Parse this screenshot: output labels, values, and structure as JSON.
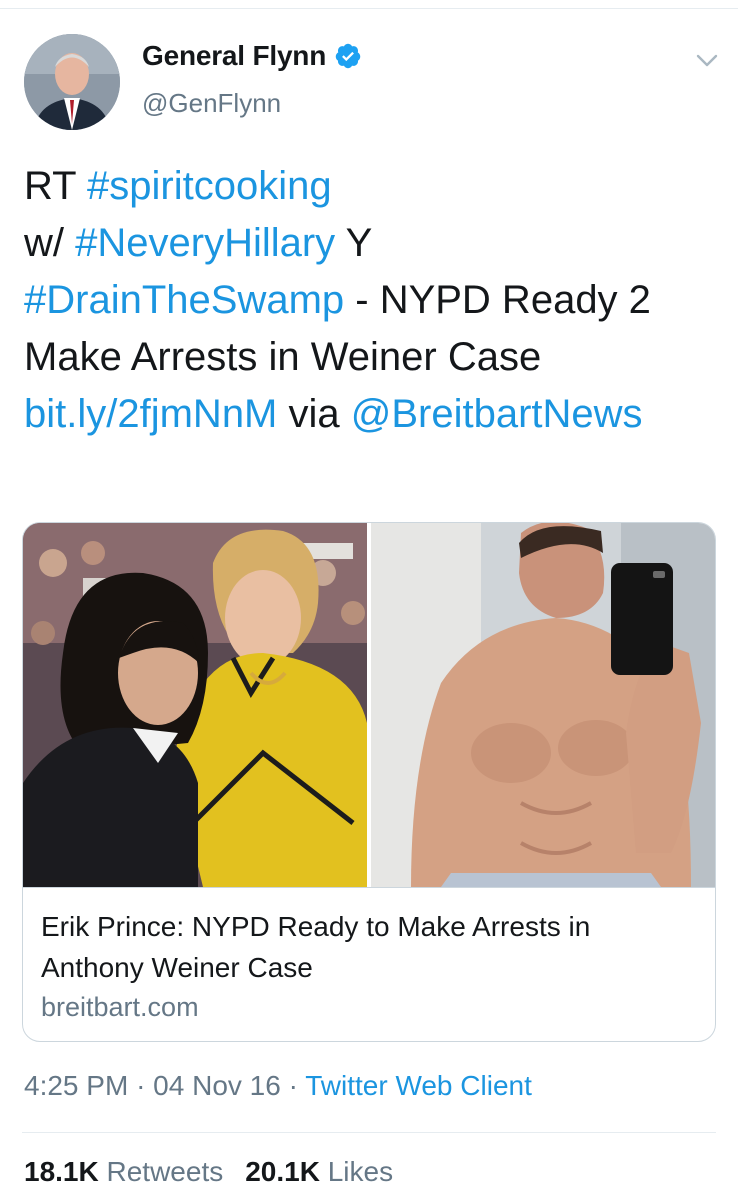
{
  "tweet": {
    "author": {
      "display_name": "General Flynn",
      "handle": "@GenFlynn",
      "verified": true
    },
    "text_parts": [
      {
        "text": "RT ",
        "link": false
      },
      {
        "text": "#spiritcooking",
        "link": true
      },
      {
        "text": " w/ ",
        "link": false
      },
      {
        "text": "#NeveryHillary",
        "link": true
      },
      {
        "text": " Y ",
        "link": false
      },
      {
        "text": "#DrainTheSwamp",
        "link": true
      },
      {
        "text": " - NYPD Ready 2 Make Arrests in Weiner Case ",
        "link": false
      },
      {
        "text": "bit.ly/2fjmNnM",
        "link": true
      },
      {
        "text": " via ",
        "link": false
      },
      {
        "text": "@BreitbartNews",
        "link": true
      }
    ],
    "card": {
      "title": "Erik Prince: NYPD Ready to Make Arrests in Anthony Weiner Case",
      "domain": "breitbart.com"
    },
    "time": "4:25 PM",
    "date": "04 Nov 16",
    "separator": "·",
    "client": "Twitter Web Client",
    "retweets_count": "18.1K",
    "retweets_label": "Retweets",
    "likes_count": "20.1K",
    "likes_label": "Likes"
  },
  "icons": {
    "verified": "verified-badge-icon",
    "menu": "chevron-down-icon"
  },
  "colors": {
    "link": "#1b95e0",
    "secondary_text": "#657786",
    "primary_text": "#14171a",
    "border": "#ccd6dd"
  }
}
